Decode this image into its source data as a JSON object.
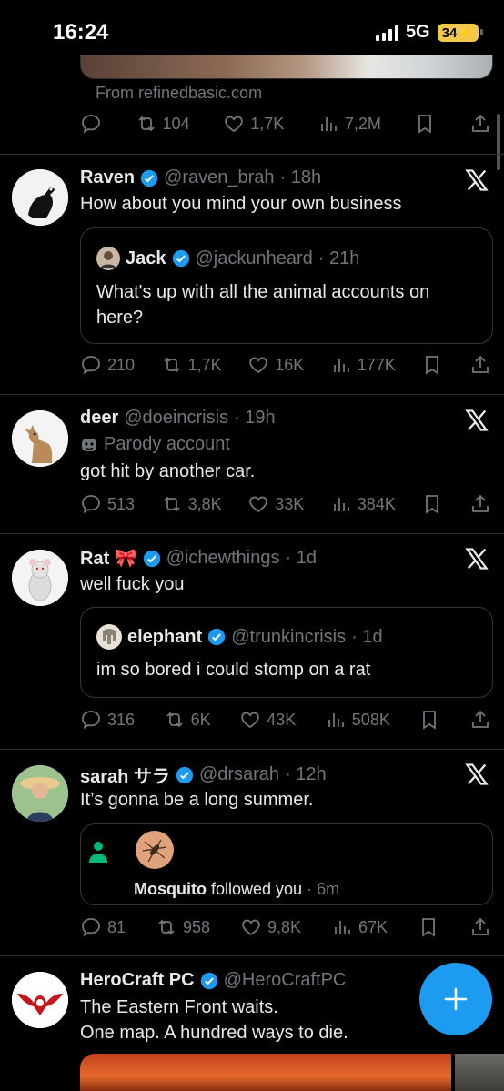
{
  "status": {
    "time": "16:24",
    "network": "5G",
    "battery": "34"
  },
  "prev_post": {
    "source": "From refinedbasic.com",
    "actions": {
      "reposts": "104",
      "likes": "1,7K",
      "views": "7,2M"
    }
  },
  "posts": [
    {
      "name": "Raven",
      "handle": "@raven_brah",
      "time": "· 18h",
      "text": "How about you mind your own business",
      "quote": {
        "name": "Jack",
        "handle": "@jackunheard",
        "time": "· 21h",
        "text": "What's up with all the animal accounts on here?"
      },
      "actions": {
        "replies": "210",
        "reposts": "1,7K",
        "likes": "16K",
        "views": "177K"
      }
    },
    {
      "name": "deer",
      "handle": "@doeincrisis",
      "time": "· 19h",
      "label": "Parody account",
      "text": "got hit by another car.",
      "actions": {
        "replies": "513",
        "reposts": "3,8K",
        "likes": "33K",
        "views": "384K"
      }
    },
    {
      "name": "Rat 🎀",
      "handle": "@ichewthings",
      "time": "· 1d",
      "text": "well fuck you",
      "quote": {
        "name": "elephant",
        "handle": "@trunkincrisis",
        "time": "· 1d",
        "text": "im so bored i could stomp on a rat"
      },
      "actions": {
        "replies": "316",
        "reposts": "6K",
        "likes": "43K",
        "views": "508K"
      }
    },
    {
      "name": "sarah サラ",
      "handle": "@drsarah",
      "time": "· 12h",
      "text": "It’s gonna be a long summer.",
      "notification": {
        "name": "Mosquito",
        "text": "followed you",
        "time": "· 6m"
      },
      "actions": {
        "replies": "81",
        "reposts": "958",
        "likes": "9,8K",
        "views": "67K"
      }
    },
    {
      "name": "HeroCraft PC",
      "handle": "@HeroCraftPC",
      "text_line1": "The Eastern Front waits.",
      "text_line2": "One map. A hundred ways to die."
    }
  ],
  "colors": {
    "accent": "#1d9bf0",
    "verified": "#1d9bf0",
    "muted": "#71767b",
    "bg": "#000000"
  }
}
